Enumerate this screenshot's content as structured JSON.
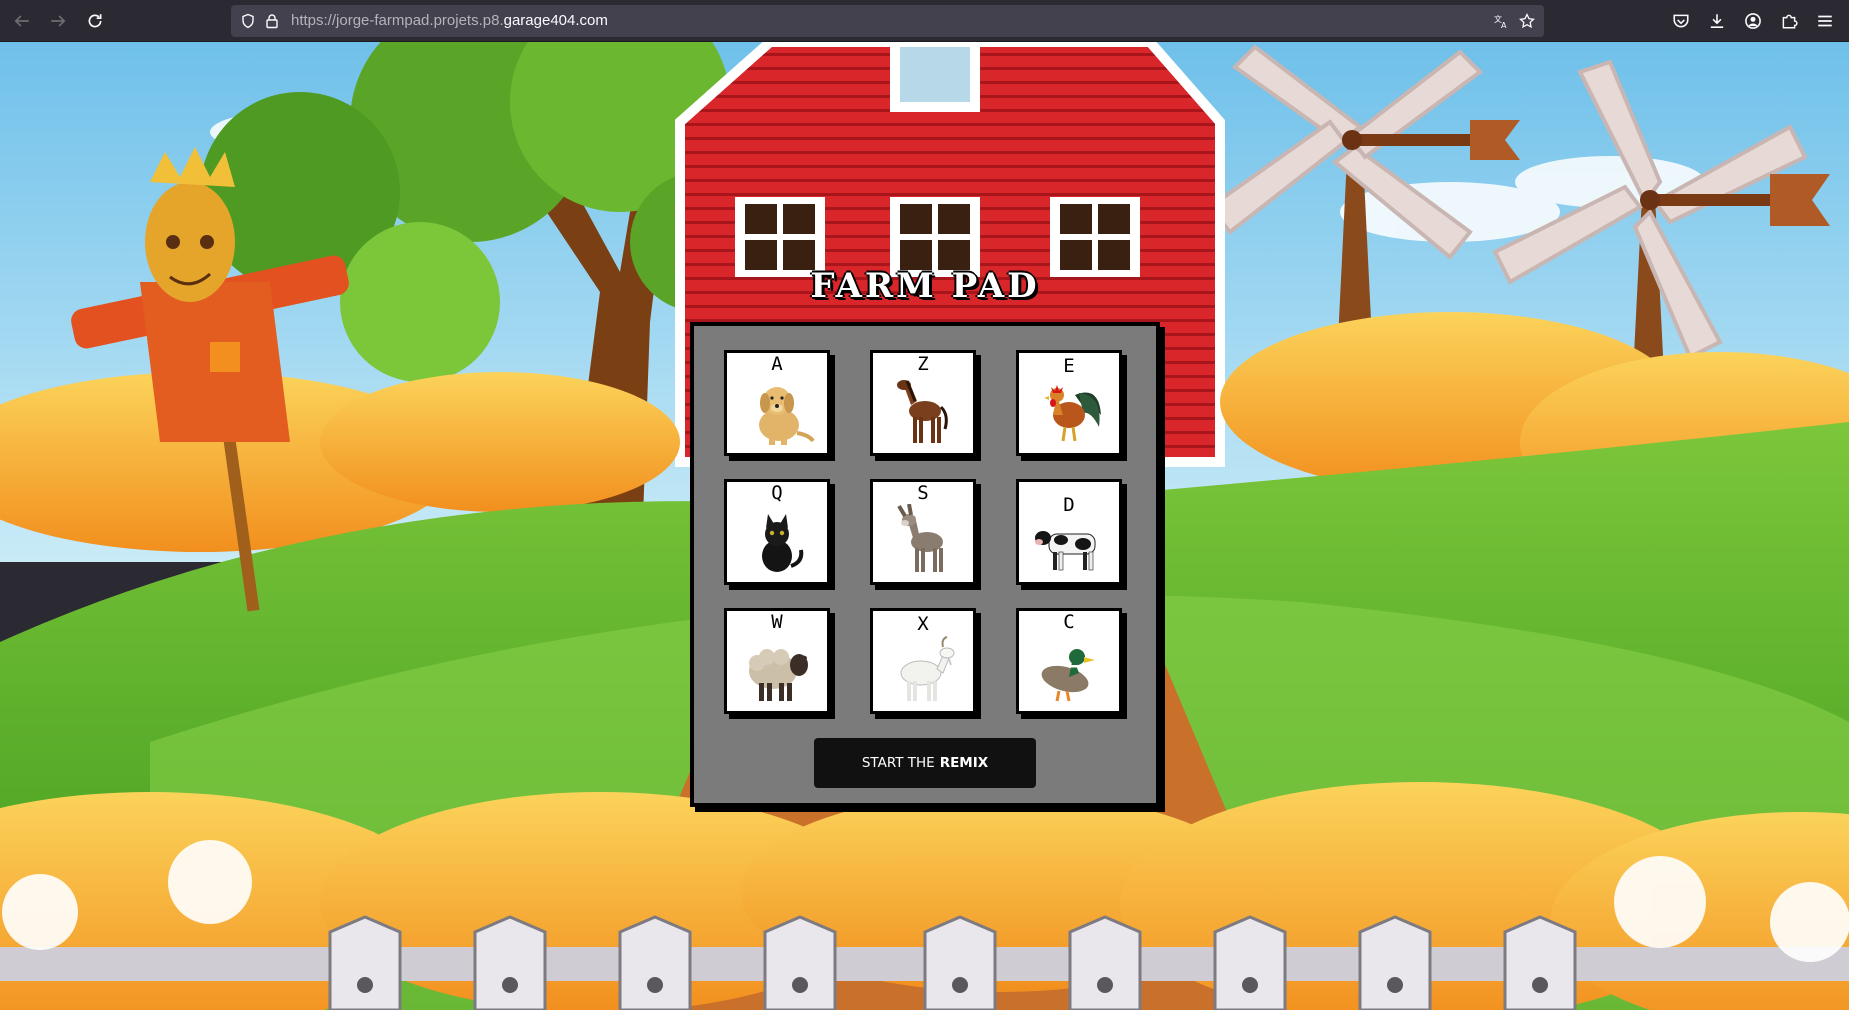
{
  "browser": {
    "url_prefix": "https://jorge-farmpad.projets.p8.",
    "url_domain": "garage404.com",
    "icons": [
      "back-icon",
      "forward-icon",
      "reload-icon",
      "shield-icon",
      "lock-icon",
      "translate-icon",
      "bookmark-star-icon",
      "pocket-icon",
      "download-icon",
      "account-icon",
      "extensions-icon",
      "menu-icon"
    ]
  },
  "app": {
    "title": "FARM PAD",
    "keys": [
      {
        "letter": "A",
        "animal": "dog"
      },
      {
        "letter": "Z",
        "animal": "horse"
      },
      {
        "letter": "E",
        "animal": "rooster"
      },
      {
        "letter": "Q",
        "animal": "cat"
      },
      {
        "letter": "S",
        "animal": "donkey"
      },
      {
        "letter": "D",
        "animal": "cow"
      },
      {
        "letter": "W",
        "animal": "sheep"
      },
      {
        "letter": "X",
        "animal": "goat"
      },
      {
        "letter": "C",
        "animal": "duck"
      }
    ],
    "start_button": {
      "prefix": "START THE",
      "emphasis": "REMIX"
    }
  },
  "colors": {
    "pad_bg": "#7b7b7b",
    "barn_red": "#d8262a",
    "sky": "#8ecdf0",
    "grass": "#5fb82e",
    "button_bg": "#111111"
  }
}
